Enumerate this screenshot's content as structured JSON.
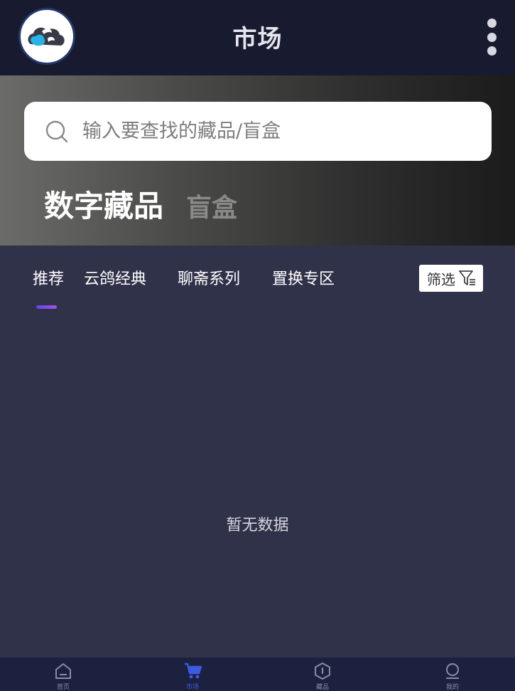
{
  "header": {
    "title": "市场"
  },
  "search": {
    "placeholder": "输入要查找的藏品/盲盒"
  },
  "categories": [
    {
      "label": "数字藏品",
      "active": true
    },
    {
      "label": "盲盒",
      "active": false
    }
  ],
  "sub_tabs": [
    {
      "label": "推荐",
      "active": true
    },
    {
      "label": "云鸽经典",
      "active": false
    },
    {
      "label": "聊斋系列",
      "active": false
    },
    {
      "label": "置换专区",
      "active": false
    }
  ],
  "filter": {
    "label": "筛选"
  },
  "empty_state": {
    "text": "暂无数据"
  },
  "bottom_nav": [
    {
      "label": "首页",
      "icon": "home-icon",
      "active": false
    },
    {
      "label": "市场",
      "icon": "cart-icon",
      "active": true
    },
    {
      "label": "藏品",
      "icon": "collection-icon",
      "active": false
    },
    {
      "label": "我的",
      "icon": "profile-icon",
      "active": false
    }
  ],
  "colors": {
    "header_bg": "#181a30",
    "page_bg": "#30324a",
    "nav_bg": "#1d2140",
    "accent": "#3d5be0",
    "indicator_start": "#5a4ce0",
    "indicator_end": "#a64ee6"
  }
}
